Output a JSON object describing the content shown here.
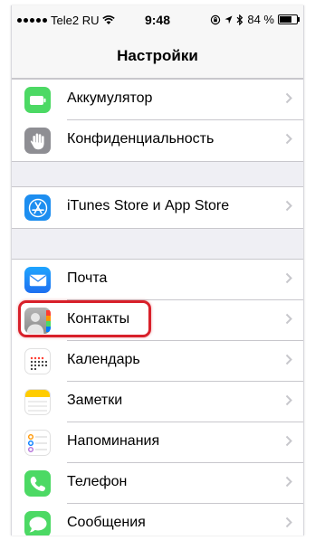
{
  "status_bar": {
    "carrier": "Tele2 RU",
    "time": "9:48",
    "battery_percent": "84 %",
    "battery_level": 0.84
  },
  "nav": {
    "title": "Настройки"
  },
  "groups": [
    {
      "items": [
        {
          "label": "Аккумулятор",
          "icon": "battery-icon",
          "color": "#4cd964"
        },
        {
          "label": "Конфиденциальность",
          "icon": "hand-icon",
          "color": "#8e8e93"
        }
      ]
    },
    {
      "items": [
        {
          "label": "iTunes Store и App Store",
          "icon": "app-store-icon",
          "color": "#1d8ef0"
        }
      ]
    },
    {
      "items": [
        {
          "label": "Почта",
          "icon": "mail-icon",
          "color": "#2c8ef8"
        },
        {
          "label": "Контакты",
          "icon": "contacts-icon",
          "color": "#9a9a9a"
        },
        {
          "label": "Календарь",
          "icon": "calendar-icon",
          "color": "#ffffff"
        },
        {
          "label": "Заметки",
          "icon": "notes-icon",
          "color": "#ffcc00"
        },
        {
          "label": "Напоминания",
          "icon": "reminders-icon",
          "color": "#ffffff"
        },
        {
          "label": "Телефон",
          "icon": "phone-icon",
          "color": "#4cd964"
        },
        {
          "label": "Сообщения",
          "icon": "messages-icon",
          "color": "#4cd964"
        }
      ]
    }
  ],
  "highlight": {
    "target": "Контакты",
    "color": "#d8202a"
  }
}
